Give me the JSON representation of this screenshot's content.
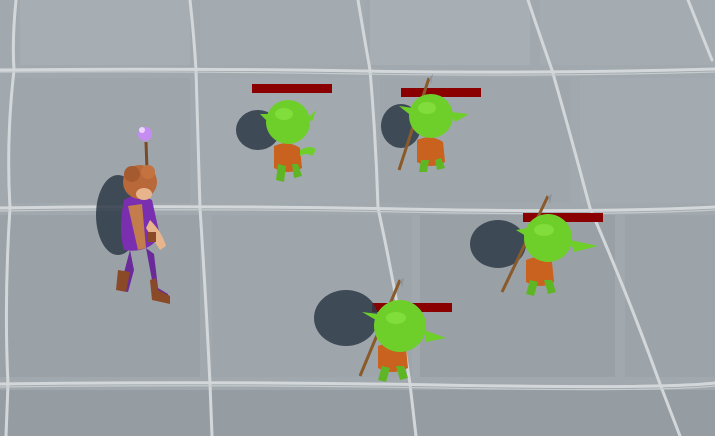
{
  "colors": {
    "floor_tile": "#a1a9ae",
    "grout": "#d2d6d8",
    "shadow": "#2e3a48",
    "goblin_skin": "#6fcf2a",
    "goblin_armor": "#c8621e",
    "hero_hair": "#b9683a",
    "hero_outfit": "#7a2fb0",
    "magic_orb": "#c58cf2",
    "health_bar": "#8a0000"
  },
  "hero": {
    "role": "player-hero",
    "weapon_icon": "magic-staff-icon"
  },
  "enemies": [
    {
      "id": "goblin-1",
      "health_fraction": 1.0,
      "weapon": "none"
    },
    {
      "id": "goblin-2",
      "health_fraction": 1.0,
      "weapon": "spear"
    },
    {
      "id": "goblin-3",
      "health_fraction": 1.0,
      "weapon": "spear"
    },
    {
      "id": "goblin-4",
      "health_fraction": 1.0,
      "weapon": "spear"
    }
  ]
}
